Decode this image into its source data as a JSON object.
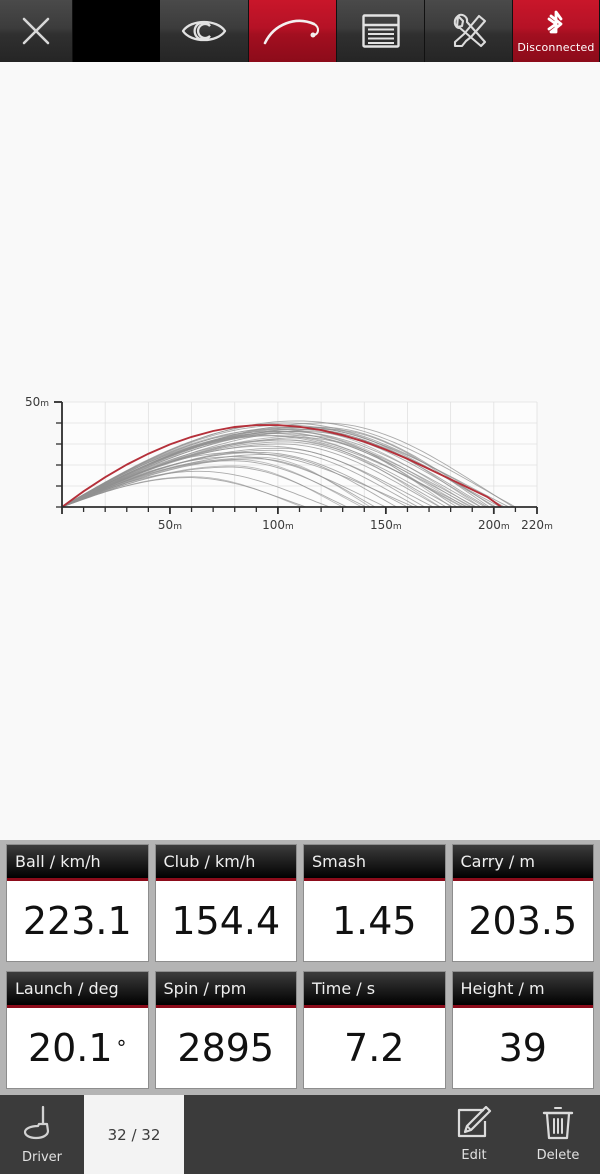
{
  "toolbar": {
    "close": {
      "icon": "close-x-icon",
      "label": ""
    },
    "view": {
      "icon": "eye-icon",
      "label": ""
    },
    "trajectory": {
      "icon": "trajectory-curve-icon",
      "label": ""
    },
    "list": {
      "icon": "list-table-icon",
      "label": ""
    },
    "tools": {
      "icon": "tools-wrench-screwdriver-icon",
      "label": ""
    },
    "bluetooth": {
      "icon": "bluetooth-icon",
      "label": "Disconnected"
    },
    "colors": {
      "active_tab": "#b51226",
      "status": "#a30f20",
      "inactive": "#3c3c3c"
    }
  },
  "chart_data": {
    "type": "line",
    "title": "",
    "xlabel": "",
    "ylabel": "",
    "xlim": [
      0,
      220
    ],
    "ylim": [
      0,
      50
    ],
    "x_tick_labels": [
      "50m",
      "100m",
      "150m",
      "200m",
      "220m"
    ],
    "x_tick_values": [
      50,
      100,
      150,
      200,
      220
    ],
    "x_minor_tick_step": 10,
    "y_tick_labels": [
      "50m"
    ],
    "y_tick_values": [
      50
    ],
    "y_minor_tick_step": 10,
    "grid": true,
    "grid_x_step": 20,
    "grid_y_step": 10,
    "legend": "none",
    "highlight_color": "#b5303a",
    "history_color": "#909090",
    "highlighted_series": {
      "name": "current-shot",
      "carry": 203.5,
      "apex": 39,
      "points": [
        [
          0,
          0
        ],
        [
          10,
          7.5
        ],
        [
          20,
          14.2
        ],
        [
          30,
          20.2
        ],
        [
          40,
          25.4
        ],
        [
          50,
          29.8
        ],
        [
          60,
          33.4
        ],
        [
          70,
          36.2
        ],
        [
          80,
          38.1
        ],
        [
          90,
          39.0
        ],
        [
          100,
          39.0
        ],
        [
          110,
          38.2
        ],
        [
          120,
          36.6
        ],
        [
          130,
          34.2
        ],
        [
          140,
          31.1
        ],
        [
          150,
          27.3
        ],
        [
          160,
          22.9
        ],
        [
          170,
          18.1
        ],
        [
          180,
          13.2
        ],
        [
          190,
          8.3
        ],
        [
          197,
          4.8
        ],
        [
          203.5,
          0
        ]
      ]
    },
    "history_series_count": 31,
    "history_series": [
      {
        "name": "shot-1",
        "carry": 188,
        "apex": 34
      },
      {
        "name": "shot-2",
        "carry": 196,
        "apex": 36
      },
      {
        "name": "shot-3",
        "carry": 205,
        "apex": 40
      },
      {
        "name": "shot-4",
        "carry": 178,
        "apex": 31
      },
      {
        "name": "shot-5",
        "carry": 210,
        "apex": 41
      },
      {
        "name": "shot-6",
        "carry": 165,
        "apex": 27
      },
      {
        "name": "shot-7",
        "carry": 192,
        "apex": 35
      },
      {
        "name": "shot-8",
        "carry": 200,
        "apex": 38
      },
      {
        "name": "shot-9",
        "carry": 150,
        "apex": 24
      },
      {
        "name": "shot-10",
        "carry": 183,
        "apex": 33
      },
      {
        "name": "shot-11",
        "carry": 172,
        "apex": 29
      },
      {
        "name": "shot-12",
        "carry": 198,
        "apex": 37
      },
      {
        "name": "shot-13",
        "carry": 141,
        "apex": 22
      },
      {
        "name": "shot-14",
        "carry": 207,
        "apex": 39
      },
      {
        "name": "shot-15",
        "carry": 160,
        "apex": 26
      },
      {
        "name": "shot-16",
        "carry": 190,
        "apex": 36
      },
      {
        "name": "shot-17",
        "carry": 175,
        "apex": 30
      },
      {
        "name": "shot-18",
        "carry": 203,
        "apex": 38
      },
      {
        "name": "shot-19",
        "carry": 132,
        "apex": 19
      },
      {
        "name": "shot-20",
        "carry": 186,
        "apex": 34
      },
      {
        "name": "shot-21",
        "carry": 168,
        "apex": 28
      },
      {
        "name": "shot-22",
        "carry": 194,
        "apex": 36
      },
      {
        "name": "shot-23",
        "carry": 155,
        "apex": 25
      },
      {
        "name": "shot-24",
        "carry": 201,
        "apex": 38
      },
      {
        "name": "shot-25",
        "carry": 145,
        "apex": 23
      },
      {
        "name": "shot-26",
        "carry": 181,
        "apex": 32
      },
      {
        "name": "shot-27",
        "carry": 163,
        "apex": 26
      },
      {
        "name": "shot-28",
        "carry": 197,
        "apex": 37
      },
      {
        "name": "shot-29",
        "carry": 124,
        "apex": 17
      },
      {
        "name": "shot-30",
        "carry": 209,
        "apex": 40
      },
      {
        "name": "shot-31",
        "carry": 113,
        "apex": 14
      }
    ]
  },
  "metrics": [
    [
      {
        "header": "Ball / km/h",
        "value": "223.1",
        "suffix": ""
      },
      {
        "header": "Club / km/h",
        "value": "154.4",
        "suffix": ""
      },
      {
        "header": "Smash",
        "value": "1.45",
        "suffix": ""
      },
      {
        "header": "Carry / m",
        "value": "203.5",
        "suffix": ""
      }
    ],
    [
      {
        "header": "Launch / deg",
        "value": "20.1",
        "suffix": "°"
      },
      {
        "header": "Spin / rpm",
        "value": "2895",
        "suffix": ""
      },
      {
        "header": "Time / s",
        "value": "7.2",
        "suffix": ""
      },
      {
        "header": "Height / m",
        "value": "39",
        "suffix": ""
      }
    ]
  ],
  "bottom_bar": {
    "club": {
      "icon": "golf-driver-icon",
      "label": "Driver"
    },
    "shot_counter": "32 / 32",
    "edit": {
      "icon": "edit-pencil-icon",
      "label": "Edit"
    },
    "delete": {
      "icon": "trash-can-icon",
      "label": "Delete"
    }
  }
}
